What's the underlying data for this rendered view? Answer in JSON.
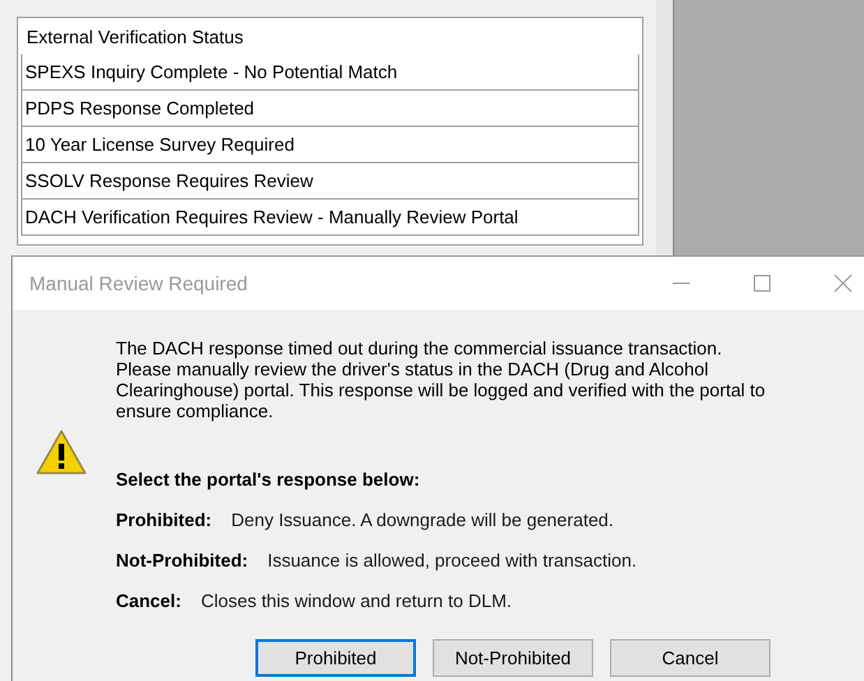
{
  "status_list": {
    "header": "External Verification Status",
    "items": [
      "SPEXS Inquiry Complete - No Potential Match",
      "PDPS Response Completed",
      "10 Year License Survey Required",
      "SSOLV Response Requires Review",
      "DACH Verification Requires Review - Manually Review Portal"
    ]
  },
  "dialog": {
    "title": "Manual Review Required",
    "message": "The DACH response timed out during the commercial issuance transaction. Please manually review the driver's status in the DACH (Drug and Alcohol Clearinghouse) portal. This response will be logged and verified with the portal to ensure compliance.",
    "prompt": "Select the portal's response below:",
    "options": [
      {
        "label": "Prohibited:",
        "description": "Deny Issuance. A downgrade will be generated."
      },
      {
        "label": "Not-Prohibited:",
        "description": "Issuance is allowed, proceed with transaction."
      },
      {
        "label": "Cancel:",
        "description": "Closes this window and return to DLM."
      }
    ],
    "buttons": [
      {
        "label": "Prohibited",
        "selected": true
      },
      {
        "label": "Not-Prohibited",
        "selected": false
      },
      {
        "label": "Cancel",
        "selected": false
      }
    ]
  }
}
